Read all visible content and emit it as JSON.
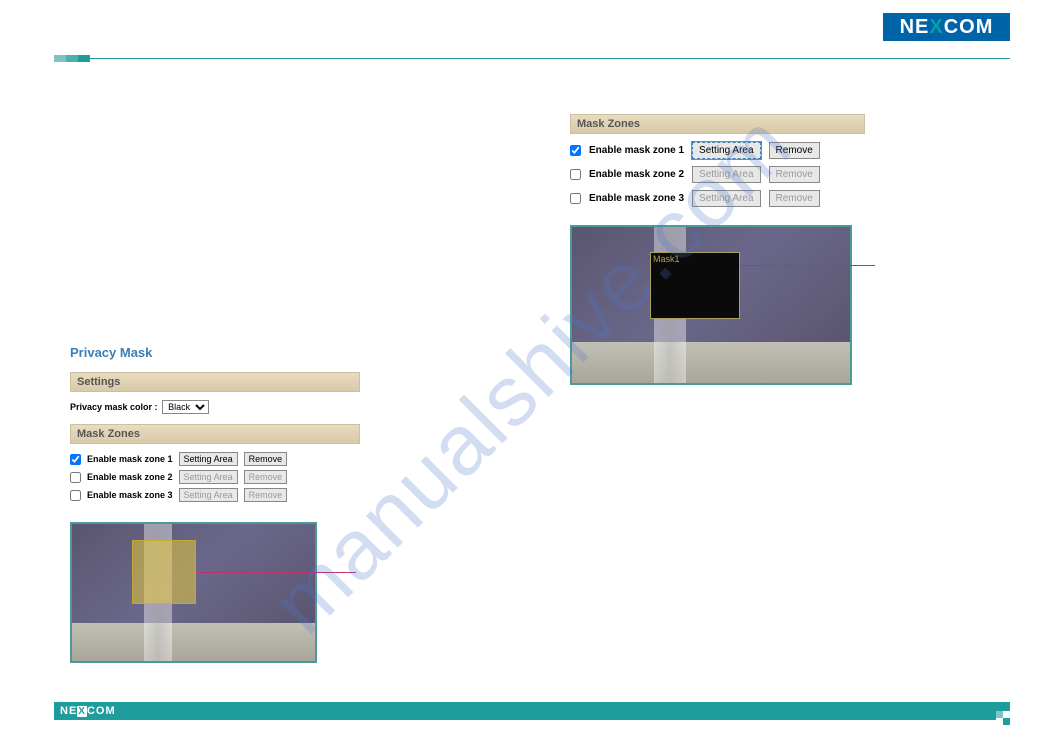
{
  "brand": {
    "name": "NEXCOM",
    "part1": "NE",
    "x": "X",
    "part2": "COM"
  },
  "watermark": "manualshive.com",
  "left": {
    "title": "Privacy Mask",
    "settings_header": "Settings",
    "mask_color_label": "Privacy mask color :",
    "mask_color_value": "Black",
    "zones_header": "Mask Zones",
    "zones": [
      {
        "label": "Enable mask zone 1",
        "checked": true,
        "setting": "Setting Area",
        "remove": "Remove",
        "enabled": true
      },
      {
        "label": "Enable mask zone 2",
        "checked": false,
        "setting": "Setting Area",
        "remove": "Remove",
        "enabled": false
      },
      {
        "label": "Enable mask zone 3",
        "checked": false,
        "setting": "Setting Area",
        "remove": "Remove",
        "enabled": false
      }
    ]
  },
  "right": {
    "zones_header": "Mask Zones",
    "zones": [
      {
        "label": "Enable mask zone 1",
        "checked": true,
        "setting": "Setting Area",
        "remove": "Remove",
        "enabled": true
      },
      {
        "label": "Enable mask zone 2",
        "checked": false,
        "setting": "Setting Area",
        "remove": "Remove",
        "enabled": false
      },
      {
        "label": "Enable mask zone 3",
        "checked": false,
        "setting": "Setting Area",
        "remove": "Remove",
        "enabled": false
      }
    ],
    "mask_label": "Mask1"
  }
}
